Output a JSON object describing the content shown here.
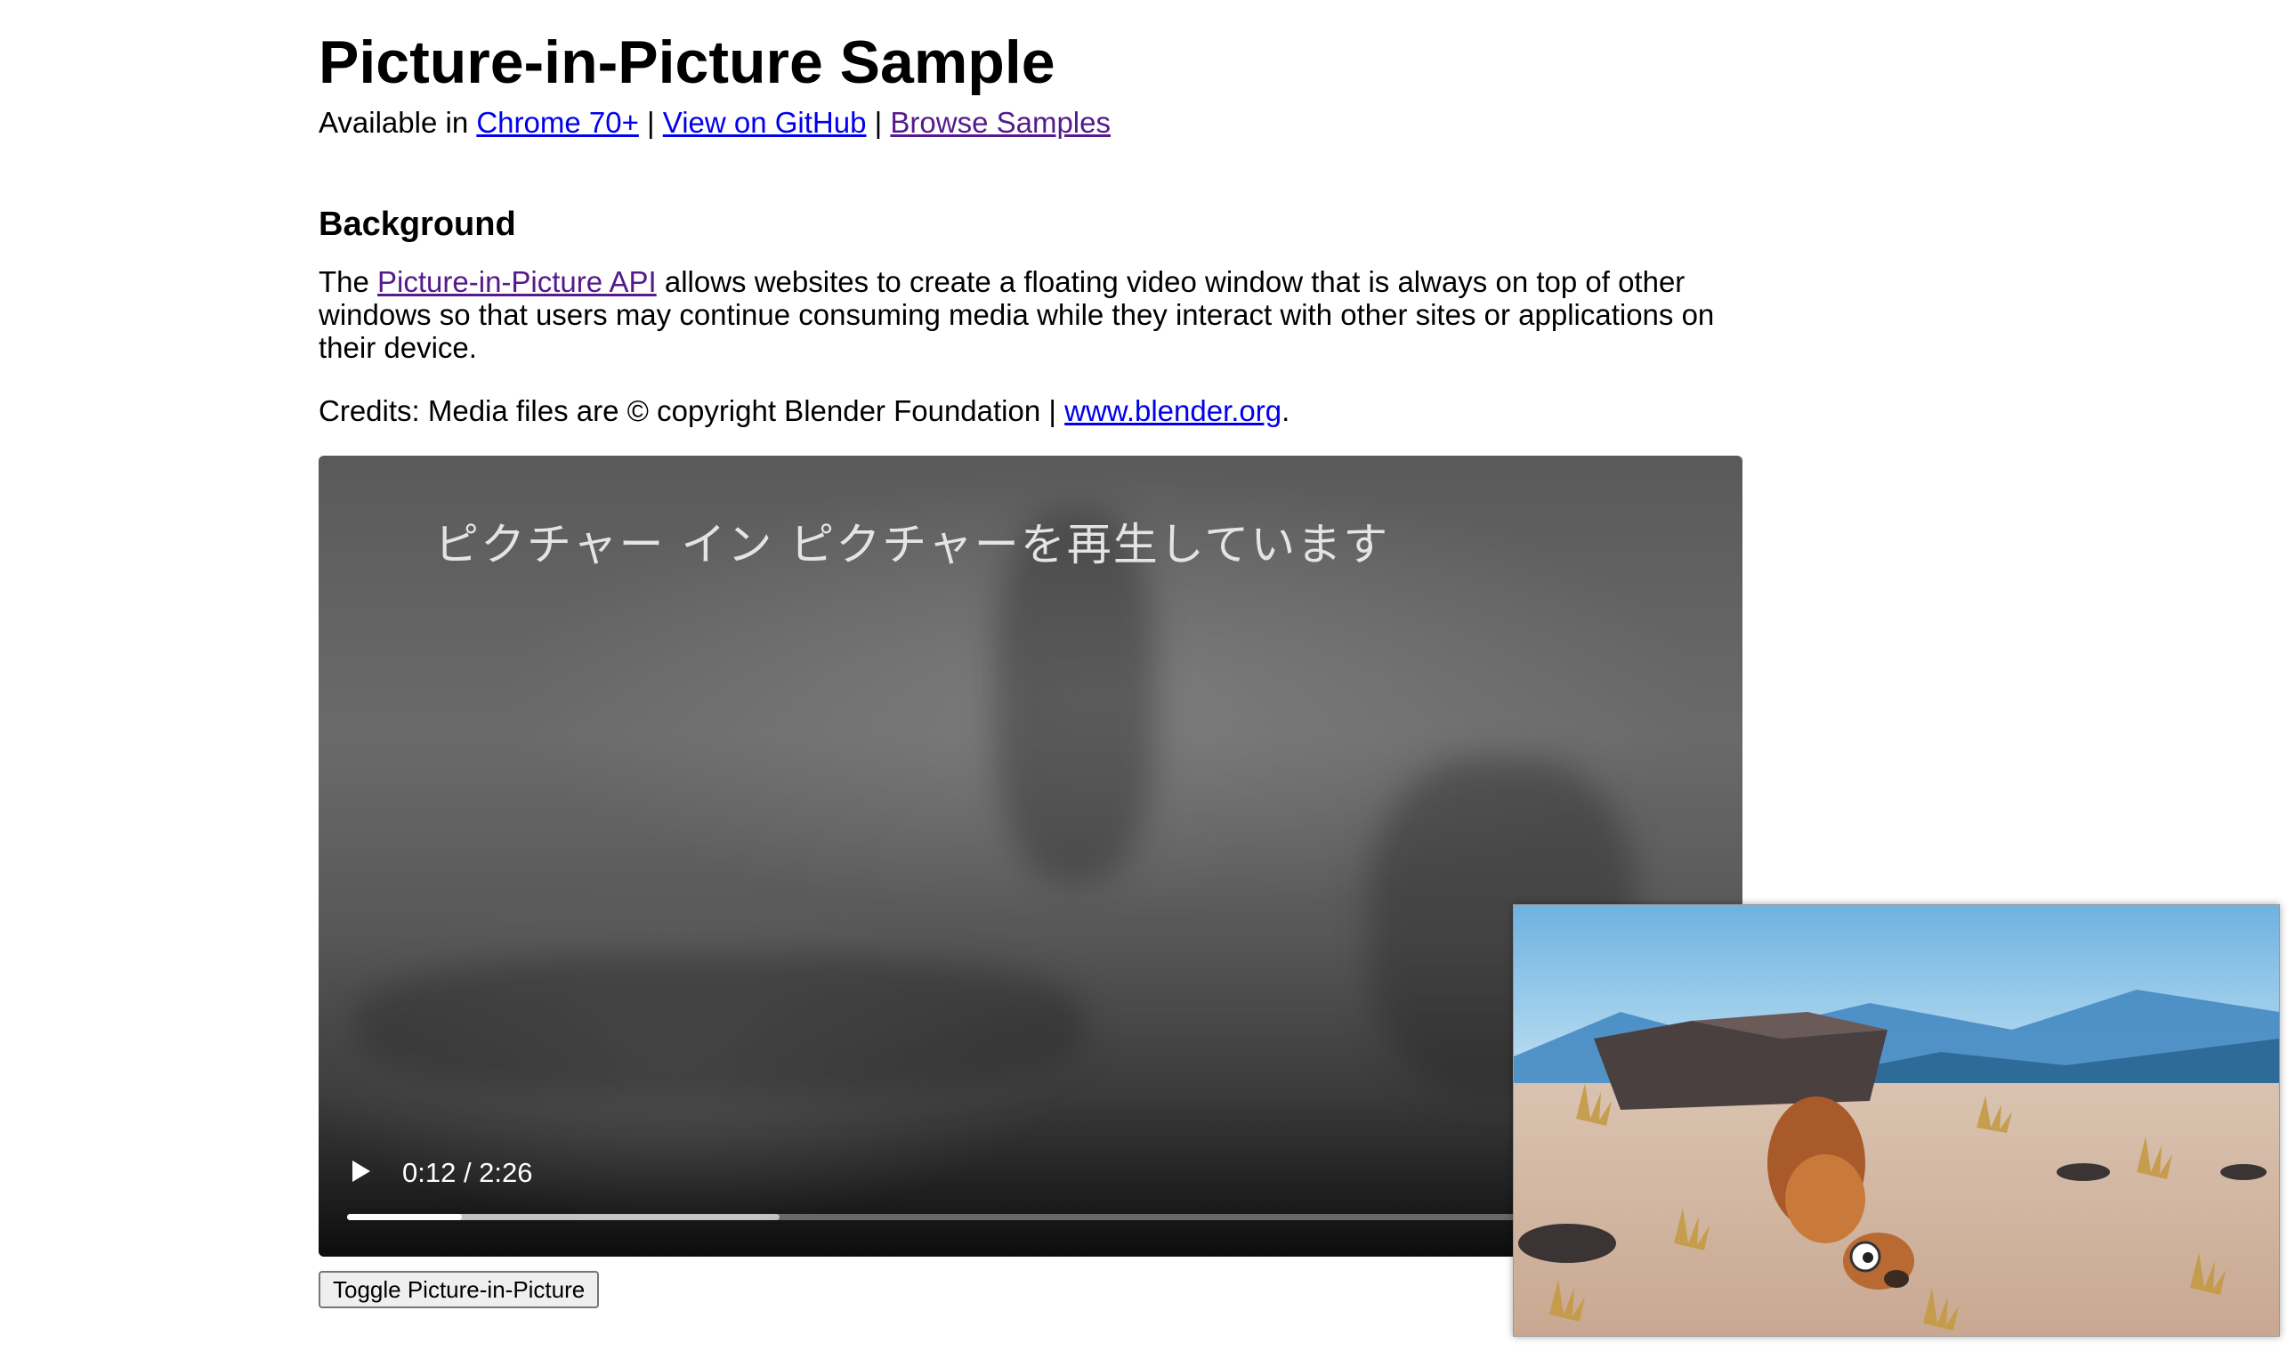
{
  "page": {
    "title": "Picture-in-Picture Sample",
    "availability": {
      "prefix": "Available in ",
      "chrome_link": "Chrome 70+",
      "separator1": " | ",
      "github_link": "View on GitHub",
      "separator2": " | ",
      "samples_link": "Browse Samples"
    },
    "background": {
      "heading": "Background",
      "text_prefix": "The ",
      "api_link": "Picture-in-Picture API",
      "text_suffix": " allows websites to create a floating video window that is always on top of other windows so that users may continue consuming media while they interact with other sites or applications on their device."
    },
    "credits": {
      "prefix": "Credits: Media files are © copyright Blender Foundation | ",
      "blender_link": "www.blender.org",
      "suffix": "."
    }
  },
  "video": {
    "pip_message": "ピクチャー イン ピクチャーを再生しています",
    "time_display": "0:12 / 2:26",
    "current_seconds": 12,
    "duration_seconds": 146,
    "buffered_fraction": 0.31,
    "play_icon": "play-icon"
  },
  "toggle_button": {
    "label": "Toggle Picture-in-Picture"
  },
  "pip_window": {
    "content": "animated-scene"
  },
  "colors": {
    "link": "#0000ee",
    "visited_link": "#551a8b",
    "player_bg": "#5a5a5a",
    "progress_played": "#ffffff"
  }
}
